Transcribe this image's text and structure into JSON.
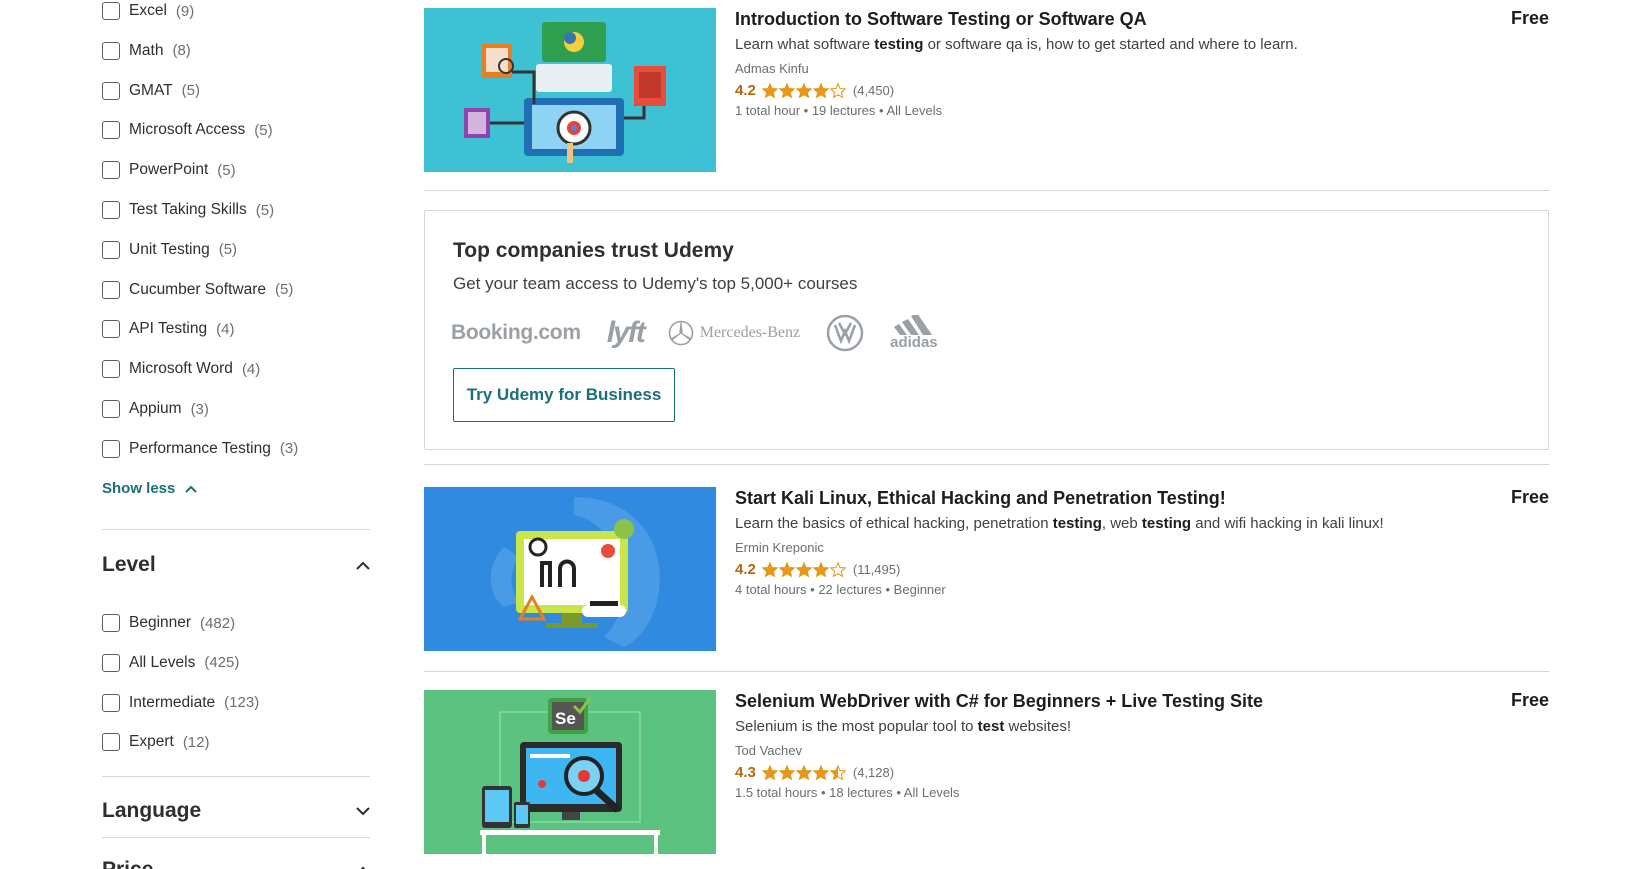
{
  "sidebar": {
    "topics": [
      {
        "label": "Excel",
        "count": "(9)"
      },
      {
        "label": "Math",
        "count": "(8)"
      },
      {
        "label": "GMAT",
        "count": "(5)"
      },
      {
        "label": "Microsoft Access",
        "count": "(5)"
      },
      {
        "label": "PowerPoint",
        "count": "(5)"
      },
      {
        "label": "Test Taking Skills",
        "count": "(5)"
      },
      {
        "label": "Unit Testing",
        "count": "(5)"
      },
      {
        "label": "Cucumber Software",
        "count": "(5)"
      },
      {
        "label": "API Testing",
        "count": "(4)"
      },
      {
        "label": "Microsoft Word",
        "count": "(4)"
      },
      {
        "label": "Appium",
        "count": "(3)"
      },
      {
        "label": "Performance Testing",
        "count": "(3)"
      }
    ],
    "show_less": "Show less",
    "level": {
      "title": "Level",
      "options": [
        {
          "label": "Beginner",
          "count": "(482)"
        },
        {
          "label": "All Levels",
          "count": "(425)"
        },
        {
          "label": "Intermediate",
          "count": "(123)"
        },
        {
          "label": "Expert",
          "count": "(12)"
        }
      ]
    },
    "language": {
      "title": "Language"
    },
    "price": {
      "title": "Price"
    }
  },
  "courses": [
    {
      "title": "Introduction to Software Testing or Software QA",
      "desc": [
        "Learn what software ",
        "testing",
        " or software qa is, how to get started and where to learn."
      ],
      "author": "Admas Kinfu",
      "rating": "4.2",
      "rating_stars": 4.2,
      "reviews": "(4,450)",
      "meta": "1 total hour • 19 lectures • All Levels",
      "price": "Free"
    },
    {
      "title": "Start Kali Linux, Ethical Hacking and Penetration Testing!",
      "desc": [
        "Learn the basics of ethical hacking, penetration ",
        "testing",
        ", web ",
        "testing",
        " and wifi hacking in kali linux!"
      ],
      "author": "Ermin Kreponic",
      "rating": "4.2",
      "rating_stars": 4.2,
      "reviews": "(11,495)",
      "meta": "4 total hours • 22 lectures • Beginner",
      "price": "Free"
    },
    {
      "title": "Selenium WebDriver with C# for Beginners + Live Testing Site",
      "desc": [
        "Selenium is the most popular tool to ",
        "test",
        " websites!"
      ],
      "author": "Tod Vachev",
      "rating": "4.3",
      "rating_stars": 4.3,
      "reviews": "(4,128)",
      "meta": "1.5 total hours • 18 lectures • All Levels",
      "price": "Free"
    }
  ],
  "business": {
    "title": "Top companies trust Udemy",
    "subtitle": "Get your team access to Udemy's top 5,000+ courses",
    "logos": [
      "Booking.com",
      "lyft",
      "Mercedes-Benz",
      "VW",
      "adidas"
    ],
    "button": "Try Udemy for Business"
  },
  "colors": {
    "accent": "#1a6f78",
    "rating": "#b4690e",
    "star": "#e59819"
  }
}
